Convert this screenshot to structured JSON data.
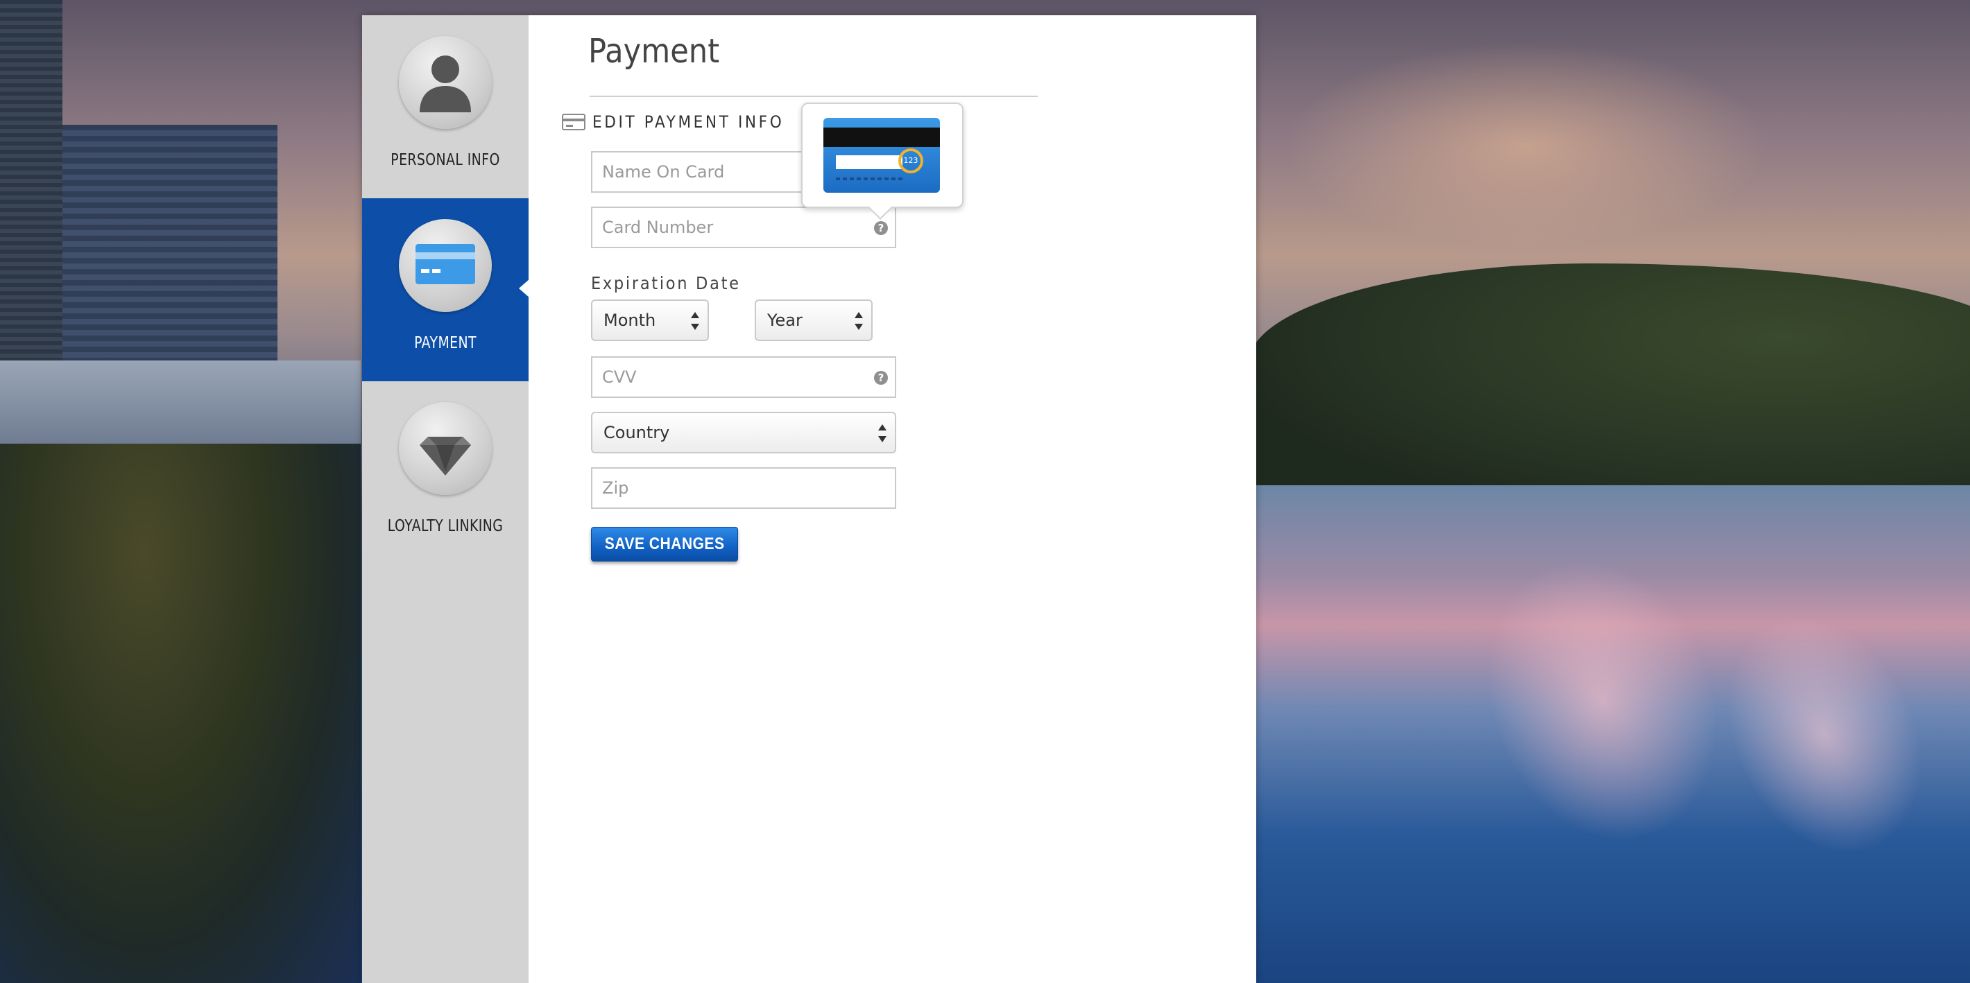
{
  "sidebar": {
    "items": [
      {
        "label": "PERSONAL INFO",
        "icon": "user-icon",
        "active": false
      },
      {
        "label": "PAYMENT",
        "icon": "credit-card-icon",
        "active": true
      },
      {
        "label": "LOYALTY LINKING",
        "icon": "diamond-icon",
        "active": false
      }
    ]
  },
  "main": {
    "title": "Payment",
    "section_title": "EDIT PAYMENT INFO",
    "form": {
      "name_on_card": {
        "placeholder": "Name On Card",
        "value": ""
      },
      "card_number": {
        "placeholder": "Card Number",
        "value": ""
      },
      "expiration_label": "Expiration Date",
      "month_select": {
        "selected": "Month"
      },
      "year_select": {
        "selected": "Year"
      },
      "cvv": {
        "placeholder": "CVV",
        "value": ""
      },
      "country_select": {
        "selected": "Country"
      },
      "zip": {
        "placeholder": "Zip",
        "value": ""
      },
      "help_glyph": "?",
      "save_label": "SAVE CHANGES"
    },
    "tooltip": {
      "cvv_sample": "123",
      "visible": true
    }
  },
  "colors": {
    "accent": "#0d4fa8",
    "sidebar_bg": "#d3d3d3",
    "button": "#1161c4",
    "cvv_ring": "#f2b32a"
  }
}
